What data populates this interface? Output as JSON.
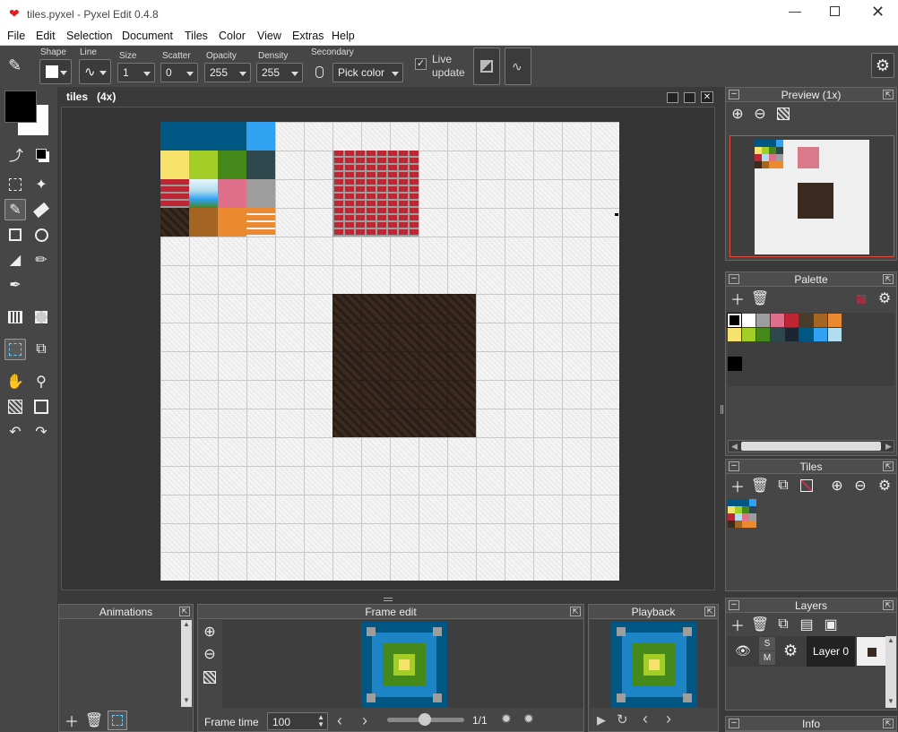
{
  "window": {
    "title": "tiles.pyxel - Pyxel Edit 0.4.8"
  },
  "menu": [
    "File",
    "Edit",
    "Selection",
    "Document",
    "Tiles",
    "Color",
    "View",
    "Extras",
    "Help"
  ],
  "toolbar": {
    "shape_label": "Shape",
    "line_label": "Line",
    "size_label": "Size",
    "size_value": "1",
    "scatter_label": "Scatter",
    "scatter_value": "0",
    "opacity_label": "Opacity",
    "opacity_value": "255",
    "density_label": "Density",
    "density_value": "255",
    "secondary_label": "Secondary",
    "secondary_value": "Pick color",
    "live_update_label": "Live update",
    "live_update_checked": true
  },
  "document": {
    "tab_title": "tiles",
    "zoom": "(4x)"
  },
  "panels": {
    "preview": {
      "title": "Preview (1x)"
    },
    "palette": {
      "title": "Palette",
      "colors": [
        "#000000",
        "#ffffff",
        "#9d9d9d",
        "#e06f8b",
        "#be2633",
        "#493c2b",
        "#a46422",
        "#eb8931",
        "#f7e26b",
        "#a3ce27",
        "#44891a",
        "#2f484e",
        "#1b2632",
        "#005784",
        "#31a2f2",
        "#b2dcef"
      ],
      "extra_color": "#000000"
    },
    "tiles": {
      "title": "Tiles"
    },
    "layers": {
      "title": "Layers",
      "layer_name": "Layer 0",
      "solo_label": "S",
      "mute_label": "M"
    },
    "info": {
      "title": "Info"
    },
    "animations": {
      "title": "Animations"
    },
    "frame_edit": {
      "title": "Frame edit",
      "frame_time_label": "Frame time",
      "frame_time_value": "100",
      "frame_counter": "1/1"
    },
    "playback": {
      "title": "Playback"
    }
  },
  "colors": {
    "bg_dark": "#3a3a3a",
    "panel": "#464646",
    "grid": "#efefef",
    "brick": "#be2633",
    "dirt": "#3b2a20",
    "accent_red": "#e24b3b"
  }
}
